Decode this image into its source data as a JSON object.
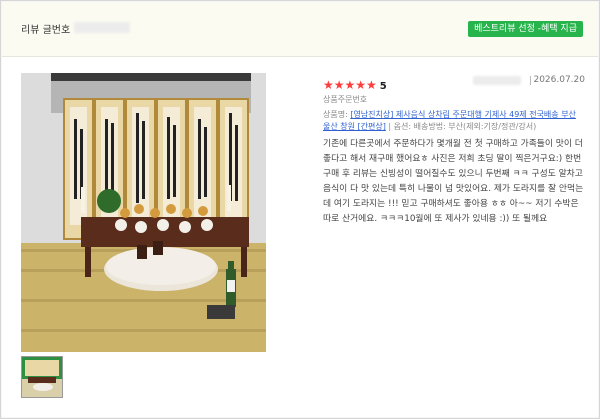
{
  "header": {
    "label": "리뷰 글번호",
    "badge": "베스트리뷰 선정 -혜택 지급"
  },
  "review": {
    "stars": "★★★★★",
    "score": "5",
    "date": "2026.07.20",
    "order_label": "상품주문번호",
    "product_prefix": "상품명:",
    "product_link": "[영남진치상] 제사음식 상차림 주문대행 기제사 49제 전국배송 부산 울산 창원 [간편상]",
    "option_sep": "|",
    "option": "옵션: 배송방법: 부산(제외:기장/정관/강서)",
    "body": "기존에 다른곳에서 주문하다가 몇개월 전 첫 구매하고 가족들이 맛이 더 좋다고 해서 재구매 했어요ㅎ 사진은 저희 초딩 딸이 찍은거구요:) 한번 구매 후 리뷰는 신빙성이 떨어질수도 있으니 두번째 ㅋㅋ 구성도 알차고 음식이 다 맛 있는데 특히 나물이 넘 맛있어요. 제가 도라지를 잘 안먹는데 여기 도라지는 !!! 믿고 구매하셔도 좋아용 ㅎㅎ 아~~ 저기 수박은 따로 산거에요. ㅋㅋㅋ10월에 또 제사가 있네용 :)) 또 될께요"
  },
  "colors": {
    "badge": "#28b44c",
    "stars": "#ff3b3b",
    "link": "#2f62d0"
  }
}
